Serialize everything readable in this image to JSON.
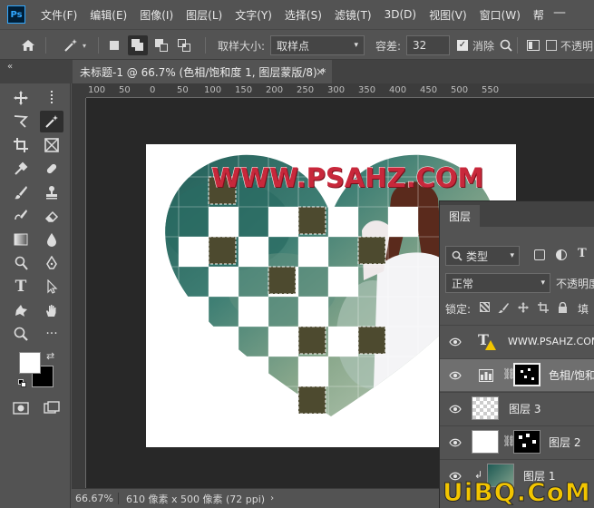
{
  "app": {
    "logo": "Ps"
  },
  "menu": [
    "文件(F)",
    "编辑(E)",
    "图像(I)",
    "图层(L)",
    "文字(Y)",
    "选择(S)",
    "滤镜(T)",
    "3D(D)",
    "视图(V)",
    "窗口(W)",
    "帮"
  ],
  "options": {
    "sample_size_label": "取样大小:",
    "sample_size_value": "取样点",
    "tolerance_label": "容差:",
    "tolerance_value": "32",
    "antialias_label": "消除",
    "contiguous_label": "不透明"
  },
  "tab": {
    "title": "未标题-1 @ 66.7% (色相/饱和度 1, 图层蒙版/8) *",
    "close": "×"
  },
  "ruler": {
    "ticks": [
      "100",
      "50",
      "0",
      "50",
      "100",
      "150",
      "200",
      "250",
      "300",
      "350",
      "400",
      "450",
      "500",
      "550"
    ]
  },
  "canvas": {
    "watermark": "WWW.PSAHZ.COM"
  },
  "status": {
    "zoom": "66.67%",
    "doc_size": "610 像素 x 500 像素 (72 ppi)"
  },
  "layers_panel": {
    "tab": "图层",
    "filter_kind": "类型",
    "blend_mode": "正常",
    "opacity_label": "不透明度",
    "lock_label": "锁定:",
    "fill_label": "填",
    "layers": [
      {
        "name": "WWW.PSAHZ.COM",
        "kind": "text"
      },
      {
        "name": "色相/饱和",
        "kind": "adjustment"
      },
      {
        "name": "图层 3",
        "kind": "pixel"
      },
      {
        "name": "图层 2",
        "kind": "pixel"
      },
      {
        "name": "图层 1",
        "kind": "photo"
      }
    ]
  },
  "site_watermark": "UiBQ.CoM"
}
